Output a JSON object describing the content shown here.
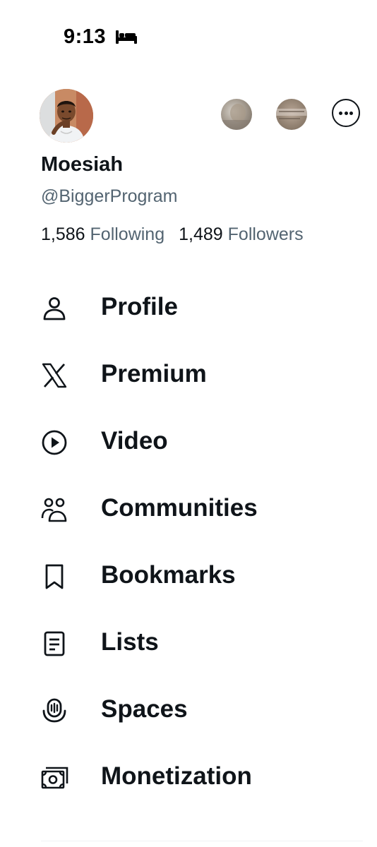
{
  "status_bar": {
    "time": "9:13",
    "focus_icon": "bed-icon"
  },
  "profile": {
    "display_name": "Moesiah",
    "handle": "@BiggerProgram",
    "following_count": "1,586",
    "following_label": "Following",
    "followers_count": "1,489",
    "followers_label": "Followers",
    "avatar": "avatar-illustration"
  },
  "accounts": {
    "switcher_1": "account-avatar",
    "switcher_2": "account-avatar",
    "more_icon": "more-options-icon"
  },
  "menu": [
    {
      "label": "Profile",
      "icon": "person-icon"
    },
    {
      "label": "Premium",
      "icon": "x-logo-icon"
    },
    {
      "label": "Video",
      "icon": "play-circle-icon"
    },
    {
      "label": "Communities",
      "icon": "communities-icon"
    },
    {
      "label": "Bookmarks",
      "icon": "bookmark-icon"
    },
    {
      "label": "Lists",
      "icon": "list-icon"
    },
    {
      "label": "Spaces",
      "icon": "spaces-mic-icon"
    },
    {
      "label": "Monetization",
      "icon": "money-icon"
    }
  ],
  "colors": {
    "text": "#0f1419",
    "secondary": "#536471",
    "background": "#ffffff"
  }
}
